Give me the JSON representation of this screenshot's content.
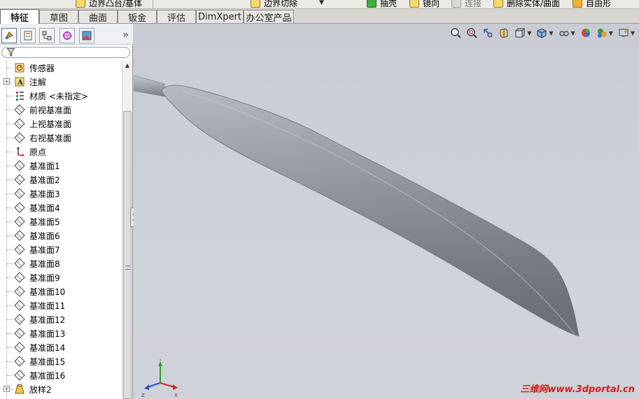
{
  "toolbar": {
    "items": [
      {
        "label": "边界凸台/基体"
      },
      {
        "label": "边界切除"
      },
      {
        "label": "抽壳"
      },
      {
        "label": "镜向"
      },
      {
        "label": "连接"
      },
      {
        "label": "删除实体/曲面"
      },
      {
        "label": "自由形"
      }
    ]
  },
  "tabs": [
    {
      "label": "特征",
      "active": true
    },
    {
      "label": "草图"
    },
    {
      "label": "曲面"
    },
    {
      "label": "钣金"
    },
    {
      "label": "评估"
    },
    {
      "label": "DimXpert"
    },
    {
      "label": "办公室产品"
    }
  ],
  "panel": {
    "expand_glyph": "»"
  },
  "tree": {
    "items": [
      {
        "label": "传感器",
        "icon": "sensor-icon"
      },
      {
        "label": "注解",
        "icon": "annotation-icon",
        "expandable": true
      },
      {
        "label": "材质 <未指定>",
        "icon": "material-icon"
      },
      {
        "label": "前视基准面",
        "icon": "plane-icon"
      },
      {
        "label": "上视基准面",
        "icon": "plane-icon"
      },
      {
        "label": "右视基准面",
        "icon": "plane-icon"
      },
      {
        "label": "原点",
        "icon": "origin-icon"
      },
      {
        "label": "基准面1",
        "icon": "plane-icon"
      },
      {
        "label": "基准面2",
        "icon": "plane-icon"
      },
      {
        "label": "基准面3",
        "icon": "plane-icon"
      },
      {
        "label": "基准面4",
        "icon": "plane-icon"
      },
      {
        "label": "基准面5",
        "icon": "plane-icon"
      },
      {
        "label": "基准面6",
        "icon": "plane-icon"
      },
      {
        "label": "基准面7",
        "icon": "plane-icon"
      },
      {
        "label": "基准面8",
        "icon": "plane-icon"
      },
      {
        "label": "基准面9",
        "icon": "plane-icon"
      },
      {
        "label": "基准面10",
        "icon": "plane-icon"
      },
      {
        "label": "基准面11",
        "icon": "plane-icon"
      },
      {
        "label": "基准面12",
        "icon": "plane-icon"
      },
      {
        "label": "基准面13",
        "icon": "plane-icon"
      },
      {
        "label": "基准面14",
        "icon": "plane-icon"
      },
      {
        "label": "基准面15",
        "icon": "plane-icon"
      },
      {
        "label": "基准面16",
        "icon": "plane-icon"
      },
      {
        "label": "放样2",
        "icon": "loft-icon",
        "expandable": true
      }
    ]
  },
  "viewport": {
    "triad": {
      "x": "X",
      "y": "Y",
      "z": "Z"
    },
    "watermark": "三维网www.3dportal.cn"
  },
  "colors": {
    "accent": "#d51b1b",
    "background": "#c9ccd3",
    "model": "#8e9299"
  }
}
